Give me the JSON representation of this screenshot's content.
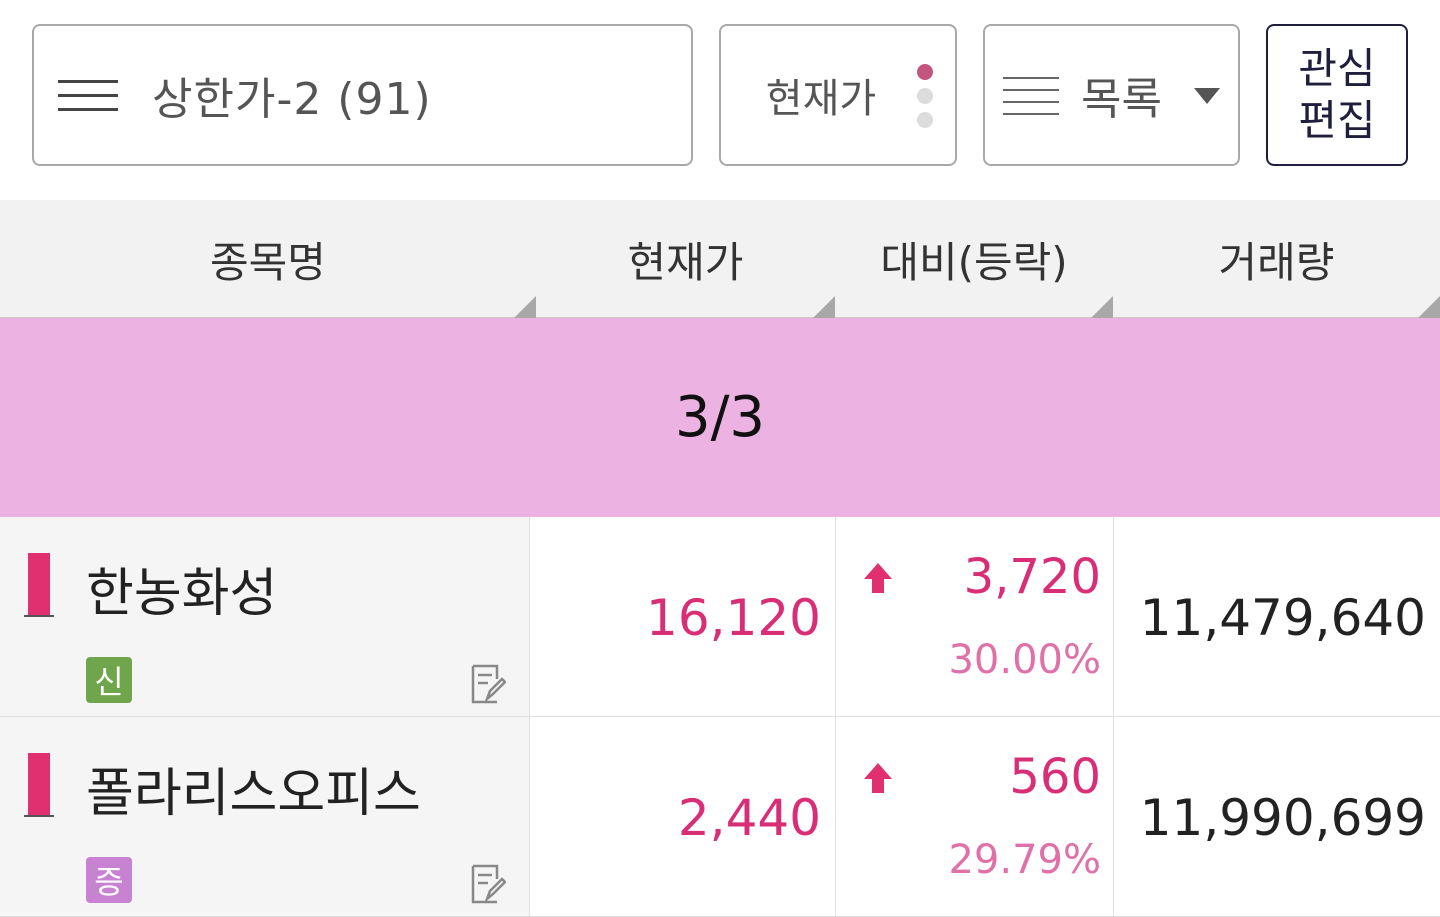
{
  "topbar": {
    "group_label": "상한가-2 (91)",
    "price_label": "현재가",
    "view_label": "목록",
    "edit_line1": "관심",
    "edit_line2": "편집"
  },
  "columns": [
    "종목명",
    "현재가",
    "대비(등락)",
    "거래량"
  ],
  "page_indicator": "3/3",
  "colors": {
    "accent": "#d92e75",
    "banner": "#ecb3e2",
    "badge_new": "#6fa64b",
    "badge_up": "#c783d2"
  },
  "rows": [
    {
      "name": "한농화성",
      "badge": "신",
      "badge_color": "#6fa64b",
      "price": "16,120",
      "change": "3,720",
      "change_pct": "30.00%",
      "volume": "11,479,640"
    },
    {
      "name": "폴라리스오피스",
      "badge": "증",
      "badge_color": "#c783d2",
      "price": "2,440",
      "change": "560",
      "change_pct": "29.79%",
      "volume": "11,990,699"
    }
  ]
}
